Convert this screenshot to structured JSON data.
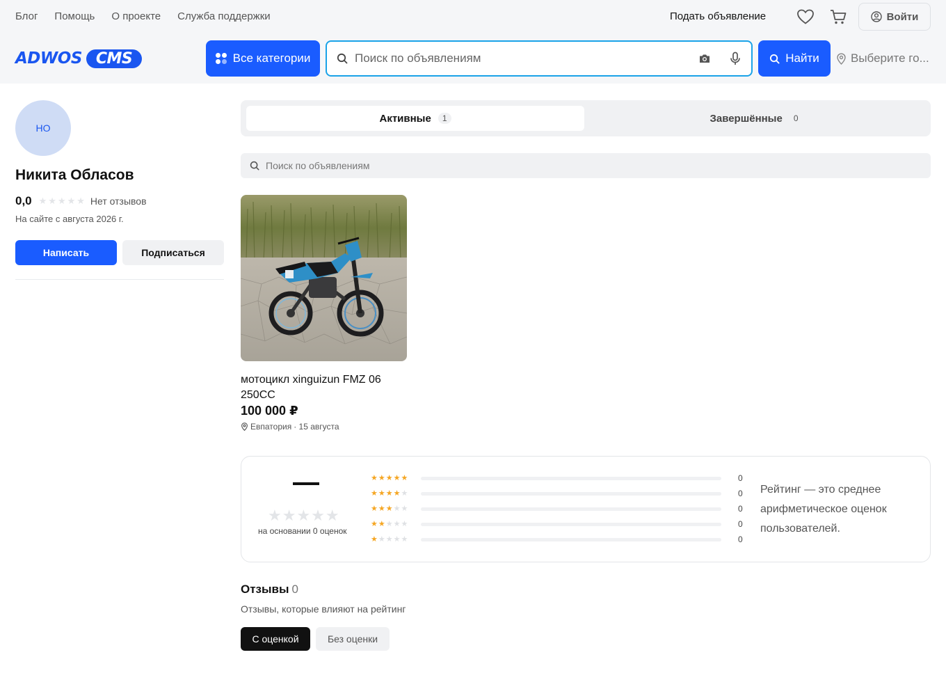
{
  "header": {
    "top_links": [
      "Блог",
      "Помощь",
      "О проекте",
      "Служба поддержки"
    ],
    "post_ad": "Подать объявление",
    "login": "Войти",
    "logo_left": "ADWOS",
    "logo_right": "CMS",
    "categories_button": "Все категории",
    "search_placeholder": "Поиск по объявлениям",
    "search_button": "Найти",
    "city_placeholder": "Выберите го...",
    "accent_color": "#1a5cff"
  },
  "profile": {
    "avatar_initials": "НО",
    "name": "Никита Обласов",
    "rating": "0,0",
    "no_reviews": "Нет отзывов",
    "since": "На сайте с августа 2026 г.",
    "write_button": "Написать",
    "subscribe_button": "Подписаться"
  },
  "tabs": {
    "active_label": "Активные",
    "active_count": "1",
    "done_label": "Завершённые",
    "done_count": "0"
  },
  "listing_search_placeholder": "Поиск по объявлениям",
  "listings": [
    {
      "title": "мотоцикл xinguizun FMZ 06 250CC",
      "price": "100 000 ₽",
      "location": "Евпатория",
      "date": "· 15 августа"
    }
  ],
  "rating_summary": {
    "score": "—",
    "based_on": "на основании 0 оценок",
    "note": "Рейтинг — это среднее арифметическое оценок пользователей.",
    "rows": [
      {
        "stars": 5,
        "count": "0",
        "fraction": 0
      },
      {
        "stars": 4,
        "count": "0",
        "fraction": 0
      },
      {
        "stars": 3,
        "count": "0",
        "fraction": 0
      },
      {
        "stars": 2,
        "count": "0",
        "fraction": 0
      },
      {
        "stars": 1,
        "count": "0",
        "fraction": 0
      }
    ]
  },
  "reviews": {
    "title": "Отзывы",
    "count": "0",
    "subtitle": "Отзывы, которые влияют на рейтинг",
    "filter_with": "С оценкой",
    "filter_without": "Без оценки"
  }
}
